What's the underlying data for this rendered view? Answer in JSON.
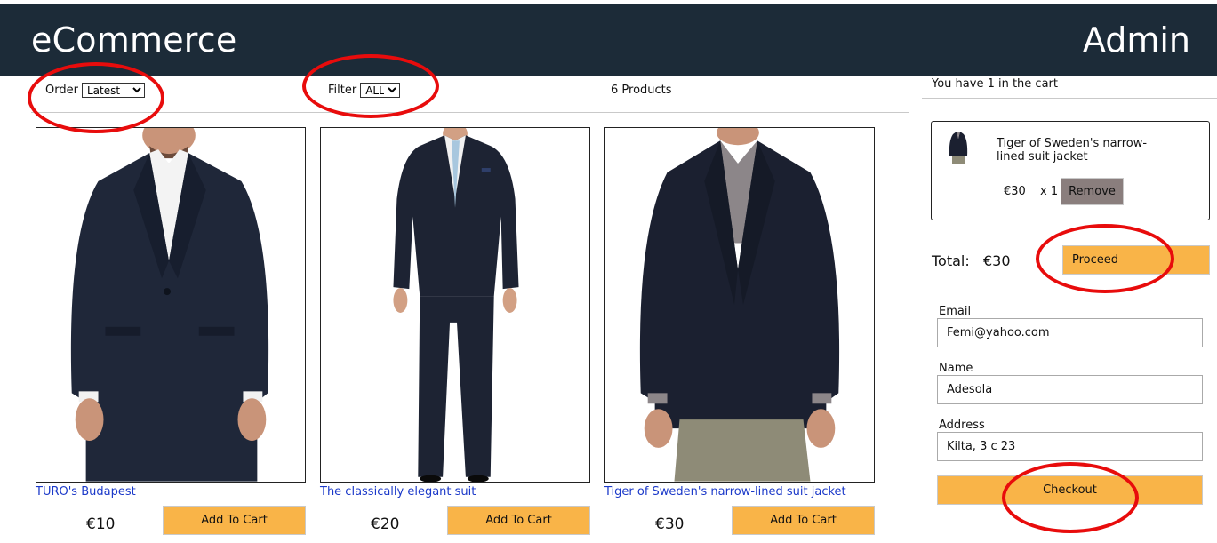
{
  "header": {
    "brand": "eCommerce",
    "admin_link": "Admin"
  },
  "filters": {
    "order_label": "Order",
    "order_value": "Latest",
    "filter_label": "Filter",
    "filter_value": "ALL",
    "product_count": "6 Products"
  },
  "products": [
    {
      "title": "TURO's Budapest",
      "price": "€10",
      "button": "Add To Cart",
      "image_icon": "navy-suit-jacket-image"
    },
    {
      "title": "The classically elegant suit",
      "price": "€20",
      "button": "Add To Cart",
      "image_icon": "full-suit-image"
    },
    {
      "title": "Tiger of Sweden's narrow-lined suit jacket",
      "price": "€30",
      "button": "Add To Cart",
      "image_icon": "jacket-khaki-image"
    }
  ],
  "cart": {
    "summary": "You have 1 in the cart",
    "items": [
      {
        "title": "Tiger of Sweden's narrow-lined suit jacket",
        "price": "€30",
        "qty": "x 1",
        "remove": "Remove"
      }
    ],
    "total_label": "Total:",
    "total_value": "€30",
    "proceed": "Proceed"
  },
  "checkout_form": {
    "email_label": "Email",
    "email_value": "Femi@yahoo.com",
    "name_label": "Name",
    "name_value": "Adesola",
    "address_label": "Address",
    "address_value": "Kilta, 3 c 23",
    "checkout": "Checkout"
  },
  "colors": {
    "header_bg": "#1c2b38",
    "accent_button": "#f9b448",
    "remove_button": "#8a7e7d",
    "link": "#1b39c9",
    "annotation": "#e80c0c"
  }
}
